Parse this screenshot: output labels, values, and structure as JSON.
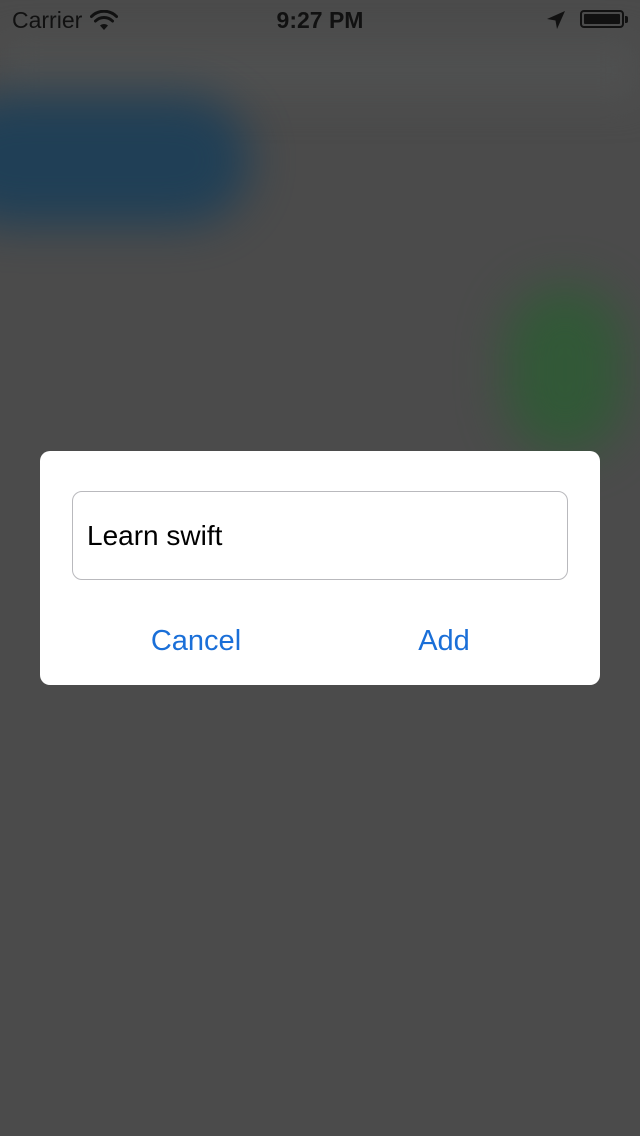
{
  "status_bar": {
    "carrier": "Carrier",
    "time": "9:27 PM",
    "battery_level": 1.0,
    "icons": [
      "wifi-icon",
      "location-arrow-icon",
      "battery-icon"
    ]
  },
  "alert": {
    "text_field_value": "Learn swift",
    "cancel_label": "Cancel",
    "add_label": "Add"
  },
  "colors": {
    "overlay": "#4a4a4a",
    "alert_background": "#ffffff",
    "action_tint": "#1a6fd8",
    "field_border": "#b9b9bd"
  }
}
